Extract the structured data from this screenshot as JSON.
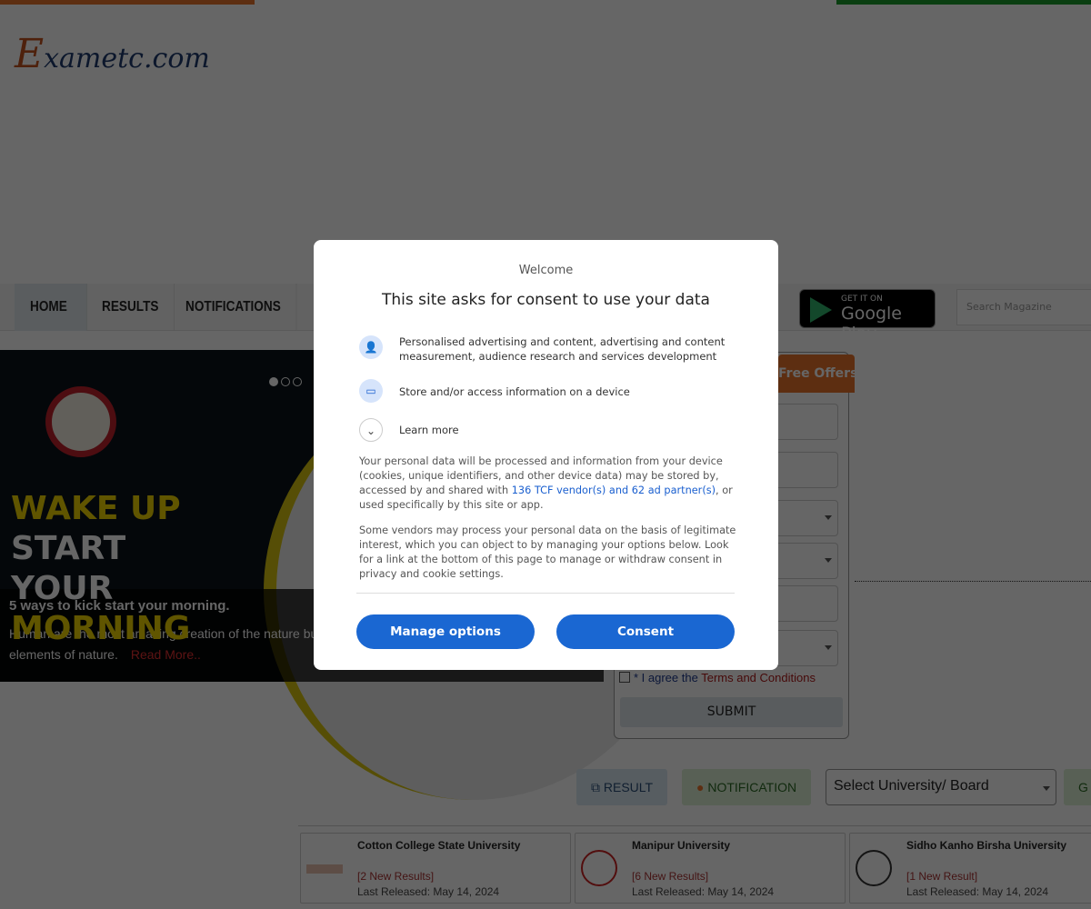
{
  "logo": {
    "first": "E",
    "rest": "xametc.com"
  },
  "nav": {
    "items": [
      "HOME",
      "RESULTS",
      "NOTIFICATIONS"
    ]
  },
  "google_play": {
    "small": "GET IT ON",
    "big": "Google Play"
  },
  "search": {
    "placeholder": "Search Magazine"
  },
  "slider": {
    "headline1": "WAKE UP",
    "headline2": "START",
    "headline3": "YOUR",
    "headline4": "MORNING",
    "caption_title": "5 ways to kick start your morning.",
    "caption_text": "Human are the most amazing creation of the nature but",
    "caption_text2": "elements of nature.",
    "read_more": "Read More.."
  },
  "form": {
    "tab": "Free Offers",
    "agree_prefix": "* I agree the",
    "terms": "Terms and Conditions",
    "submit": "SUBMIT"
  },
  "filters": {
    "result": "RESULT",
    "notification": "NOTIFICATION",
    "select": "Select University/ Board",
    "go": "G"
  },
  "cards": [
    {
      "name": "Cotton College State University",
      "new": "[2 New Results]",
      "date": "Last Released: May 14, 2024"
    },
    {
      "name": "Manipur University",
      "new": "[6 New Results]",
      "date": "Last Released: May 14, 2024"
    },
    {
      "name": "Sidho Kanho Birsha University",
      "new": "[1 New Result]",
      "date": "Last Released: May 14, 2024"
    }
  ],
  "consent": {
    "welcome": "Welcome",
    "title": "This site asks for consent to use your data",
    "purposes": [
      "Personalised advertising and content, advertising and content measurement, audience research and services development",
      "Store and/or access information on a device",
      "Learn more"
    ],
    "para1_a": "Your personal data will be processed and information from your device (cookies, unique identifiers, and other device data) may be stored by, accessed by and shared with ",
    "para1_link": "136 TCF vendor(s) and 62 ad partner(s)",
    "para1_b": ", or used specifically by this site or app.",
    "para2": "Some vendors may process your personal data on the basis of legitimate interest, which you can object to by managing your options below. Look for a link at the bottom of this page to manage or withdraw consent in privacy and cookie settings.",
    "manage": "Manage options",
    "consent": "Consent"
  },
  "colors": {
    "accent": "#1a67d2",
    "orange": "#e8742a",
    "green": "#1a9a2a"
  }
}
